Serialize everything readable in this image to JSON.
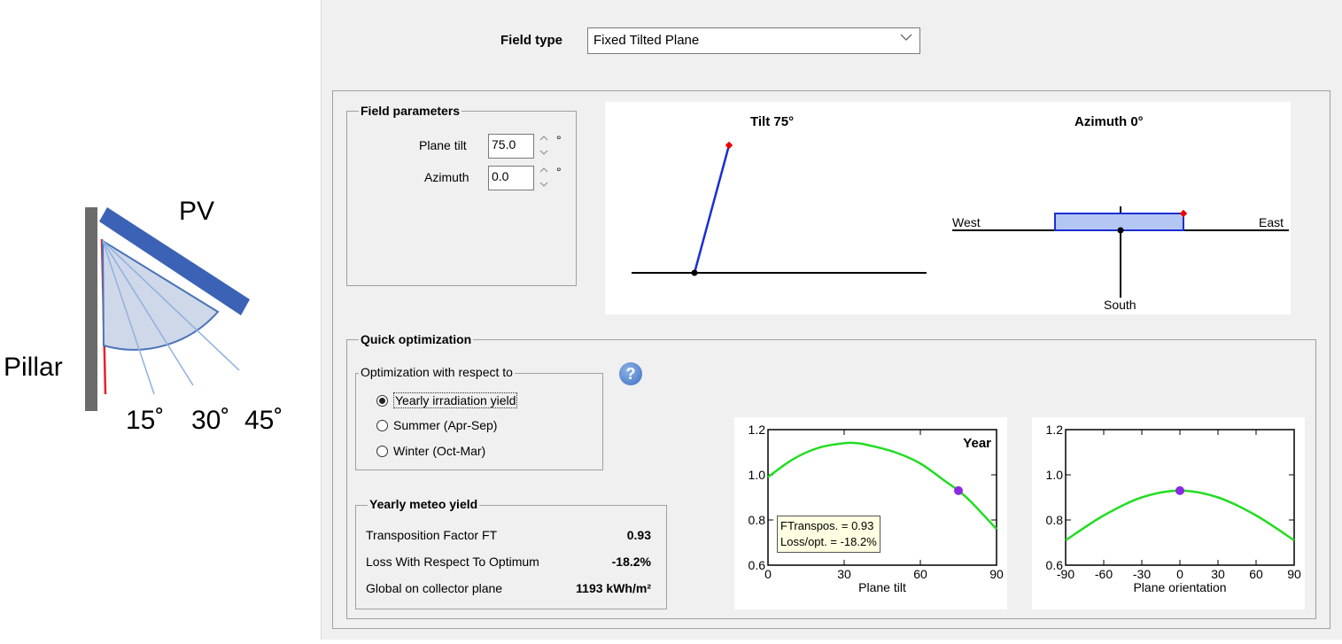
{
  "illustration": {
    "pv_label": "PV",
    "pillar_label": "Pillar",
    "angles": [
      "15˚",
      "30˚",
      "45˚"
    ]
  },
  "field_type": {
    "label": "Field type",
    "value": "Fixed Tilted Plane"
  },
  "field_parameters": {
    "title": "Field parameters",
    "plane_tilt_label": "Plane tilt",
    "plane_tilt_value": "75.0",
    "azimuth_label": "Azimuth",
    "azimuth_value": "0.0",
    "unit": "°"
  },
  "diagram": {
    "tilt_title": "Tilt 75°",
    "azimuth_title": "Azimuth 0°",
    "west": "West",
    "east": "East",
    "south": "South",
    "tilt_deg": 75,
    "azimuth_deg": 0
  },
  "quick_opt": {
    "title": "Quick optimization",
    "respect_title": "Optimization with respect to",
    "options": [
      "Yearly irradiation yield",
      "Summer (Apr-Sep)",
      "Winter (Oct-Mar)"
    ],
    "selected": 0,
    "help": "?"
  },
  "meteo": {
    "title": "Yearly meteo yield",
    "rows": [
      {
        "label": "Transposition Factor FT",
        "value": "0.93"
      },
      {
        "label": "Loss With Respect To Optimum",
        "value": "-18.2%"
      },
      {
        "label": "Global on collector plane",
        "value": "1193 kWh/m²"
      }
    ]
  },
  "chart_data": [
    {
      "type": "line",
      "annotation": "Year",
      "xlabel": "Plane tilt",
      "ylabel": "",
      "xlim": [
        0,
        90
      ],
      "ylim": [
        0.6,
        1.2
      ],
      "xticks": [
        "0",
        "30",
        "60",
        "90"
      ],
      "yticks": [
        "0.6",
        "0.8",
        "1.0",
        "1.2"
      ],
      "x": [
        0,
        10,
        20,
        30,
        35,
        40,
        50,
        60,
        70,
        75,
        80,
        90
      ],
      "y": [
        0.99,
        1.07,
        1.12,
        1.14,
        1.14,
        1.13,
        1.1,
        1.05,
        0.97,
        0.93,
        0.88,
        0.76
      ],
      "marker": {
        "x": 75,
        "y": 0.93
      },
      "tooltip": [
        "FTranspos. = 0.93",
        "Loss/opt. = -18.2%"
      ]
    },
    {
      "type": "line",
      "xlabel": "Plane orientation",
      "ylabel": "",
      "xlim": [
        -90,
        90
      ],
      "ylim": [
        0.6,
        1.2
      ],
      "xticks": [
        "-90",
        "-60",
        "-30",
        "0",
        "30",
        "60",
        "90"
      ],
      "yticks": [
        "0.6",
        "0.8",
        "1.0",
        "1.2"
      ],
      "x": [
        -90,
        -60,
        -30,
        0,
        30,
        60,
        90
      ],
      "y": [
        0.71,
        0.82,
        0.9,
        0.93,
        0.9,
        0.82,
        0.71
      ],
      "marker": {
        "x": 0,
        "y": 0.93
      }
    }
  ]
}
